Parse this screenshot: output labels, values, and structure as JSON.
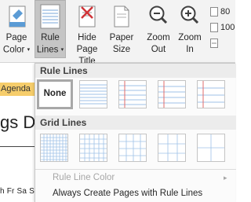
{
  "ribbon": {
    "buttons": [
      {
        "line1": "Page",
        "line2": "Color",
        "icon": "page-color-icon",
        "dropdown": true
      },
      {
        "line1": "Rule",
        "line2": "Lines",
        "icon": "rule-lines-icon",
        "dropdown": true,
        "active": true
      },
      {
        "line1": "Hide",
        "line2": "Page Title",
        "icon": "hide-page-title-icon"
      },
      {
        "line1": "Paper",
        "line2": "Size",
        "icon": "paper-size-icon"
      },
      {
        "line1": "Zoom",
        "line2": "Out",
        "icon": "zoom-out-icon"
      },
      {
        "line1": "Zoom",
        "line2": "In",
        "icon": "zoom-in-icon"
      }
    ],
    "zoom_options": [
      "80",
      "100"
    ],
    "caret_glyph": "▾"
  },
  "page": {
    "tab_label": "Agenda",
    "heading_text": "gs Dor",
    "days_text": "h Fr Sa Su"
  },
  "dropdown": {
    "rule_lines_header": "Rule Lines",
    "none_label": "None",
    "grid_lines_header": "Grid Lines",
    "menu": {
      "rule_line_color": "Rule Line Color",
      "always_create": "Always Create Pages with Rule Lines"
    }
  },
  "colors": {
    "accent_red": "#d13438",
    "rule_blue": "#9fc2e7",
    "margin_red": "#e06b6b",
    "agenda_tab": "#f6cd6b",
    "active_button": "#c5c5c5"
  }
}
